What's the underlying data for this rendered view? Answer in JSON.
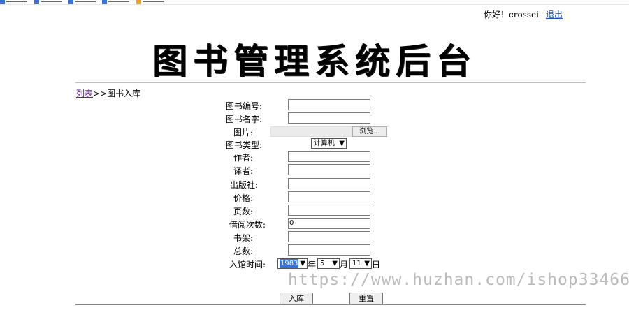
{
  "user": {
    "greeting": "你好！crossei",
    "logout": "退出"
  },
  "title": "图书管理系统后台",
  "breadcrumb": {
    "list_link": "列表",
    "current": ">>图书入库"
  },
  "form": {
    "book_id_label": "图书编号:",
    "book_name_label": "图书名字:",
    "image_label": "图片:",
    "browse": "浏览...",
    "type_label": "图书类型:",
    "type_selected": "计算机",
    "author_label": "作者:",
    "translator_label": "译者:",
    "publisher_label": "出版社:",
    "price_label": "价格:",
    "pages_label": "页数:",
    "borrow_count_label": "借阅次数:",
    "borrow_count_value": "0",
    "shelf_label": "书架:",
    "total_label": "总数:",
    "date_label": "入馆时间:",
    "year": "1983",
    "year_unit": "年",
    "month": "5",
    "month_unit": "月",
    "day": "11",
    "day_unit": "日",
    "submit": "入库",
    "reset": "重置"
  },
  "watermark": "https://www.huzhan.com/ishop33466",
  "colors": {
    "link": "#1a53c6",
    "visited": "#6a1b9a",
    "selection": "#3875d7"
  }
}
